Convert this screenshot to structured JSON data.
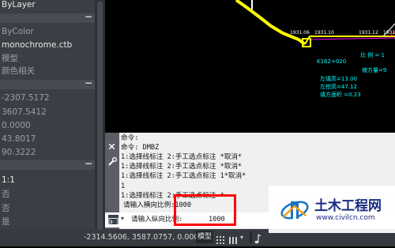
{
  "properties": {
    "layer_value": "ByLayer",
    "plot_color": "ByColor",
    "plot_style_table": "monochrome.ctb",
    "plot_mode": "模型",
    "color_dependent": "颜色相关",
    "coord_1": "-2307.5172",
    "coord_2": "3607.5412",
    "coord_3": "0.0000",
    "coord_4": "43.8017",
    "coord_5": "90.3222",
    "scale": "1:1",
    "no_1": "否",
    "no_2": "否",
    "yes": "是",
    "collapse_symbol": "−"
  },
  "drawing": {
    "station_1": "1931.06",
    "station_2": "1931.10",
    "station_3": "1931.12",
    "station_4": "1931.0",
    "ratio_label": "比 例 = 1",
    "chainage": "K162+020",
    "slope_label": "坡方量=9",
    "left_fill": "左填高=13.00",
    "left_cut": "左挖高=47.12",
    "fill_area": "填方面积 =0.23",
    "colors": {
      "road": "#ffff00",
      "guide": "#ff00ff",
      "text": "#00ffff"
    }
  },
  "command": {
    "lines": [
      "命令:",
      "命令: DMBZ",
      " 1:选择线标注 2:手工选点标注 *取消*",
      " 1:选择线标注 2:手工选点标注 *取消*",
      " 1:选择线标注 2:手工选点标注 1*取消*",
      "1",
      " 1:选择线标注 2:手工选点标注 *",
      "请输入横向比例:1000"
    ],
    "prompt_label": "请输入纵向比例:",
    "input_value": "1000",
    "highlight_color": "#ff0000"
  },
  "statusbar": {
    "coordinates": "-2314.5606, 3587.0757, 0.0000",
    "model_tab": "模型"
  },
  "watermark": {
    "title": "土木工程网",
    "url": "www.civilcn.com"
  }
}
